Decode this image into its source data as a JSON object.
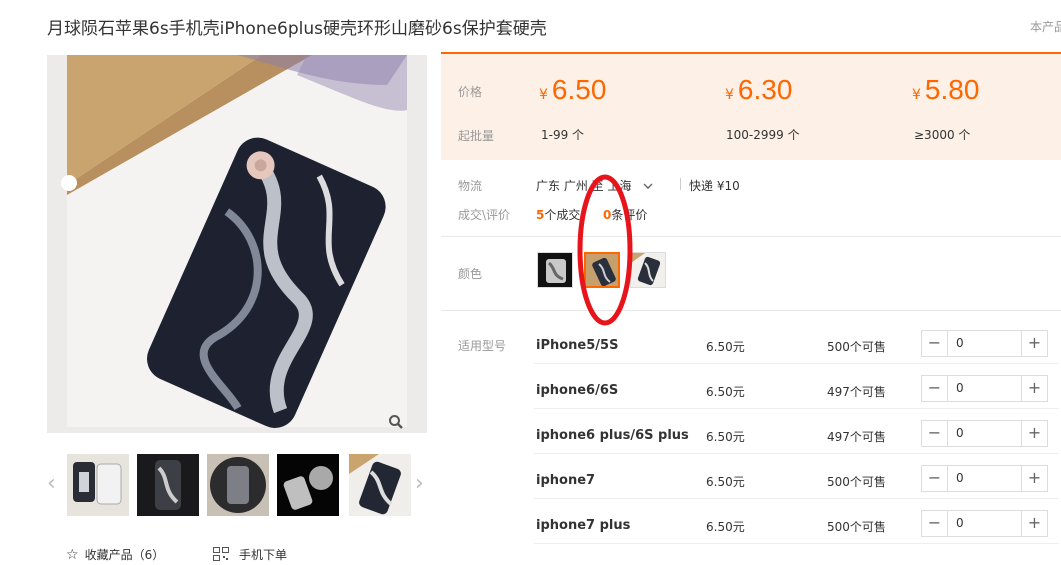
{
  "product": {
    "title": "月球陨石苹果6s手机壳iPhone6plus硬壳环形山磨砂6s保护套硬壳",
    "right_note": "本产品"
  },
  "price_panel": {
    "price_label": "价格",
    "moq_label": "起批量",
    "currency": "¥",
    "tiers": [
      {
        "price": "6.50",
        "range": "1-99 个"
      },
      {
        "price": "6.30",
        "range": "100-2999 个"
      },
      {
        "price": "5.80",
        "range": "≥3000 个"
      }
    ]
  },
  "logistics": {
    "label": "物流",
    "route": "广东 广州 至 上海",
    "express": "快递 ¥10"
  },
  "deals": {
    "label": "成交\\评价",
    "count": "5",
    "count_suffix": "个成交",
    "reviews": "0",
    "reviews_suffix": "条评价"
  },
  "color": {
    "label": "颜色",
    "selected_index": 1,
    "swatch_count": 3
  },
  "models": {
    "label": "适用型号",
    "rows": [
      {
        "name": "iPhone5/5S",
        "price": "6.50元",
        "stock": "500个可售",
        "qty": "0"
      },
      {
        "name": "iphone6/6S",
        "price": "6.50元",
        "stock": "497个可售",
        "qty": "0"
      },
      {
        "name": "iphone6 plus/6S plus",
        "price": "6.50元",
        "stock": "497个可售",
        "qty": "0"
      },
      {
        "name": "iphone7",
        "price": "6.50元",
        "stock": "500个可售",
        "qty": "0"
      },
      {
        "name": "iphone7 plus",
        "price": "6.50元",
        "stock": "500个可售",
        "qty": "0"
      }
    ]
  },
  "footer": {
    "favorite": "收藏产品（6）",
    "mobile_order": "手机下单"
  },
  "colors": {
    "accent": "#ff6600",
    "panel_bg": "#fdf0e6",
    "annotation": "#e8141b"
  }
}
